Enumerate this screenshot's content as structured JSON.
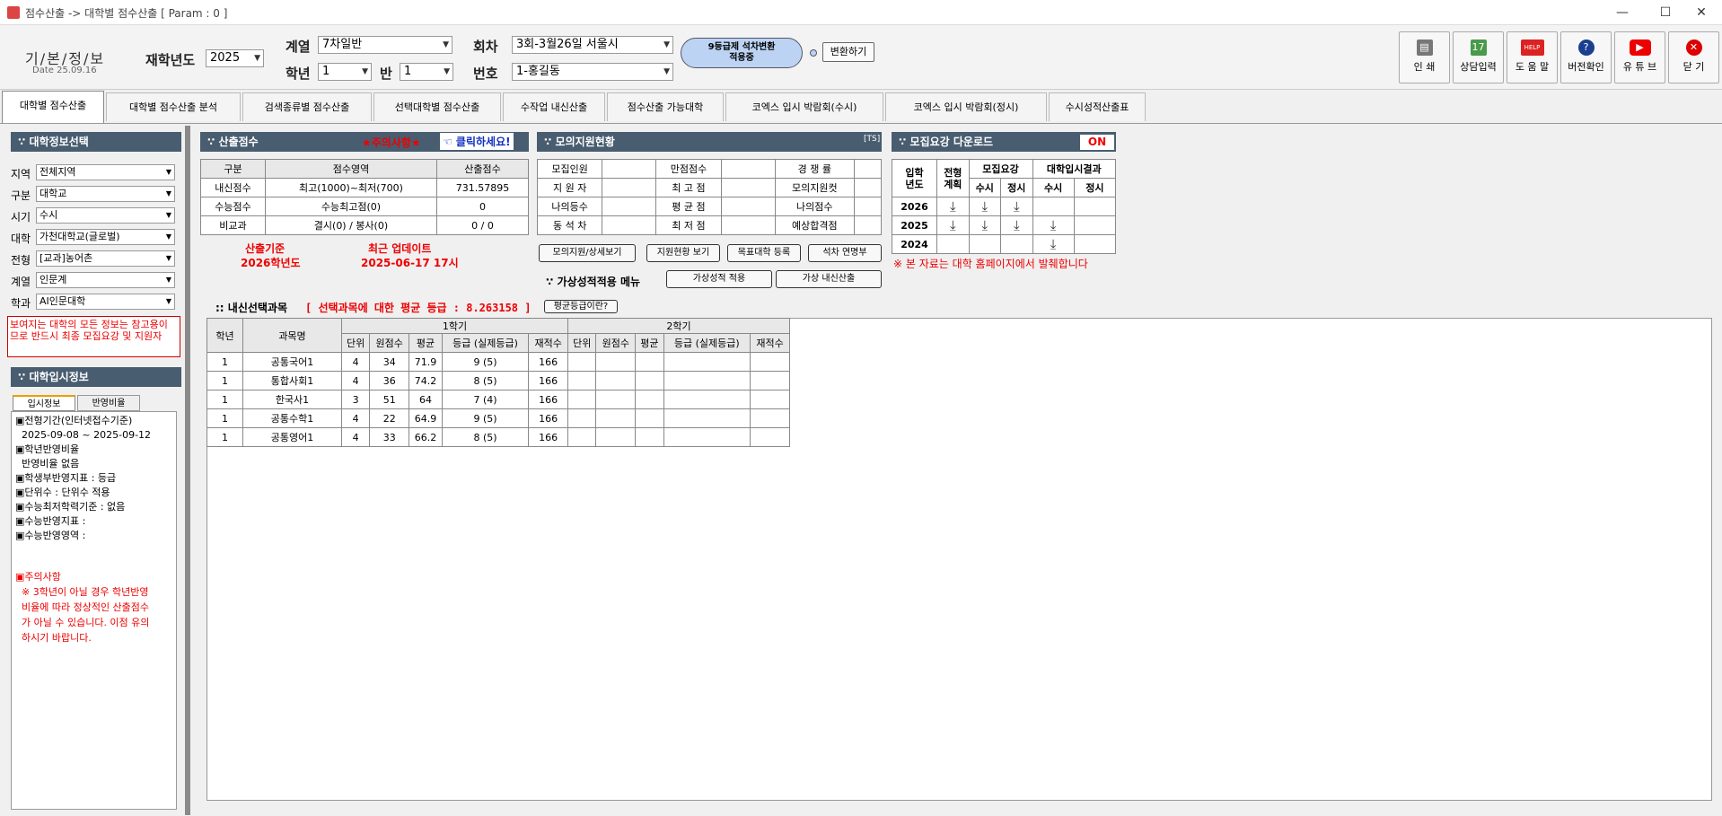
{
  "window": {
    "title": "점수산출 -> 대학별 점수산출  [ Param : 0 ]",
    "min": "—",
    "max": "☐",
    "close": "✕"
  },
  "brand": {
    "name": "기/본/정/보",
    "date": "Date 25.09.16"
  },
  "filters": {
    "year_label": "재학년도",
    "year": "2025",
    "track_label": "계열",
    "track": "7차일반",
    "grade_label": "학년",
    "grade": "1",
    "class_label": "반",
    "class": "1",
    "round_label": "회차",
    "round": "3회-3월26일  서울시",
    "number_label": "번호",
    "number": "1-홍길동",
    "cloud": "9등급제 석차변환\n적용중",
    "convert": "변환하기"
  },
  "toolbar": [
    {
      "label": "인  쇄",
      "icon": "printer-icon"
    },
    {
      "label": "상담입력",
      "icon": "calendar-icon"
    },
    {
      "label": "도 움 말",
      "icon": "help-icon"
    },
    {
      "label": "버전확인",
      "icon": "question-icon"
    },
    {
      "label": "유 튜 브",
      "icon": "youtube-icon"
    },
    {
      "label": "닫  기",
      "icon": "close-icon"
    }
  ],
  "tabs": [
    "대학별 점수산출",
    "대학별 점수산출 분석",
    "검색종류별 점수산출",
    "선택대학별 점수산출",
    "수작업 내신산출",
    "점수산출 가능대학",
    "코엑스 입시 박람회(수시)",
    "코엑스 입시 박람회(정시)",
    "수시성적산출표"
  ],
  "univ_info": {
    "title": "∵ 대학정보선택",
    "fields": [
      {
        "label": "지역",
        "value": "전체지역"
      },
      {
        "label": "구분",
        "value": "대학교"
      },
      {
        "label": "시기",
        "value": "수시"
      },
      {
        "label": "대학",
        "value": "가천대학교(글로벌)"
      },
      {
        "label": "전형",
        "value": "[교과]농어촌"
      },
      {
        "label": "계열",
        "value": "인문계"
      },
      {
        "label": "학과",
        "value": "AI인문대학"
      }
    ],
    "warning": "보여지는 대학의 모든 정보는 참고용이\n므로 반드시 최종 모집요강 및 지원자"
  },
  "admission_info": {
    "title": "∵ 대학입시정보",
    "tab1": "입시정보",
    "tab2": "반영비율",
    "lines": [
      "▣전형기간(인터넷접수기준)",
      "  2025-09-08 ~ 2025-09-12",
      "▣학년반영비율",
      "  반영비율 없음",
      "▣학생부반영지표 : 등급",
      "▣단위수 : 단위수 적용",
      "▣수능최저학력기준 : 없음",
      "▣수능반영지표 :",
      "▣수능반영영역 :"
    ],
    "caution_title": "▣주의사항",
    "caution": "  ※ 3학년이 아닐 경우 학년반영\n  비율에 따라 정상적인 산출점수\n  가 아닐 수 있습니다. 이점 유의\n  하시기 바랍니다."
  },
  "score": {
    "title": "∵ 산출점수",
    "notice": "★주의사항★",
    "click": "☜ 클릭하세요!",
    "headers": [
      "구분",
      "점수영역",
      "산출점수"
    ],
    "rows": [
      [
        "내신점수",
        "최고(1000)~최저(700)",
        "731.57895"
      ],
      [
        "수능점수",
        "수능최고점(0)",
        "0"
      ],
      [
        "비교과",
        "결시(0) / 봉사(0)",
        "0 / 0"
      ]
    ],
    "basis_title": "산출기준",
    "basis_value": "2026학년도",
    "update_title": "최근 업데이트",
    "update_value": "2025-06-17 17시"
  },
  "mock": {
    "title": "∵ 모의지원현황",
    "tag": "[TS]",
    "rows": [
      [
        "모집인원",
        "",
        "만점점수",
        "",
        "경 쟁 률",
        ""
      ],
      [
        "지 원 자",
        "",
        "최 고 점",
        "",
        "모의지원컷",
        ""
      ],
      [
        "나의등수",
        "",
        "평 균 점",
        "",
        "나의점수",
        ""
      ],
      [
        "동 석 차",
        "",
        "최 저 점",
        "",
        "예상합격점",
        ""
      ]
    ],
    "btns": [
      "모의지원/상세보기",
      "지원현황 보기",
      "목표대학 등록",
      "석차 연명부"
    ],
    "virtual_label": "∵ 가상성적적용 메뉴",
    "virtual_btns": [
      "가상성적 적용",
      "가상 내신산출"
    ]
  },
  "download": {
    "title": "∵ 모집요강 다운로드",
    "toggle": "ON",
    "h_year": "입학\n년도",
    "h_plan": "전형\n계획",
    "h_guide": "모집요강",
    "h_result": "대학입시결과",
    "h_susi": "수시",
    "h_jeongsi": "정시",
    "rows": [
      {
        "year": "2026",
        "cells": [
          true,
          true,
          true,
          false,
          false
        ]
      },
      {
        "year": "2025",
        "cells": [
          true,
          true,
          true,
          true,
          false
        ]
      },
      {
        "year": "2024",
        "cells": [
          false,
          false,
          false,
          true,
          false
        ]
      }
    ],
    "note": "※ 본 자료는 대학 홈페이지에서 발췌합니다"
  },
  "subjects": {
    "title": ":: 내신선택과목",
    "avg_text": "[ 선택과목에 대한 평균 등급 : 8.263158 ]",
    "avg_btn": "평균등급이란?",
    "h_grade": "학년",
    "h_subject": "과목명",
    "sem1": "1학기",
    "sem2": "2학기",
    "sub_headers": [
      "단위",
      "원점수",
      "평균",
      "등급 (실제등급)",
      "재적수"
    ],
    "rows": [
      {
        "grade": "1",
        "name": "공통국어1",
        "s1": [
          "4",
          "34",
          "71.9",
          "9 (5)",
          "166"
        ]
      },
      {
        "grade": "1",
        "name": "통합사회1",
        "s1": [
          "4",
          "36",
          "74.2",
          "8 (5)",
          "166"
        ]
      },
      {
        "grade": "1",
        "name": "한국사1",
        "s1": [
          "3",
          "51",
          "64",
          "7 (4)",
          "166"
        ]
      },
      {
        "grade": "1",
        "name": "공통수학1",
        "s1": [
          "4",
          "22",
          "64.9",
          "9 (5)",
          "166"
        ]
      },
      {
        "grade": "1",
        "name": "공통영어1",
        "s1": [
          "4",
          "33",
          "66.2",
          "8 (5)",
          "166"
        ]
      }
    ]
  }
}
